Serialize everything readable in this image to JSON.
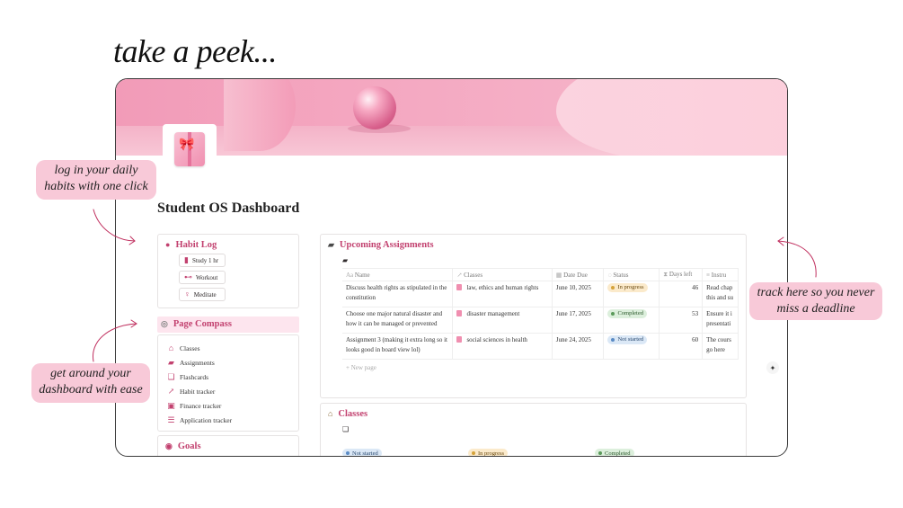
{
  "headline": "take a peek...",
  "page": {
    "title": "Student OS Dashboard"
  },
  "habit_log": {
    "title": "Habit Log",
    "buttons": [
      {
        "label": "Study 1 hr",
        "icon": "book-icon"
      },
      {
        "label": "Workout",
        "icon": "dumbbell-icon"
      },
      {
        "label": "Meditate",
        "icon": "meditate-icon"
      }
    ]
  },
  "page_compass": {
    "title": "Page Compass",
    "items": [
      {
        "label": "Classes",
        "icon": "school-icon"
      },
      {
        "label": "Assignments",
        "icon": "open-book-icon"
      },
      {
        "label": "Flashcards",
        "icon": "cards-icon"
      },
      {
        "label": "Habit tracker",
        "icon": "chart-icon"
      },
      {
        "label": "Finance tracker",
        "icon": "money-icon"
      },
      {
        "label": "Application tracker",
        "icon": "list-icon"
      }
    ]
  },
  "goals": {
    "title": "Goals"
  },
  "assignments": {
    "title": "Upcoming Assignments",
    "columns": [
      "Name",
      "Classes",
      "Date Due",
      "Status",
      "Days left",
      "Instru"
    ],
    "rows": [
      {
        "name": "Discuss health rights as stipulated in the constitution",
        "class": "law, ethics and human rights",
        "due": "June 10, 2025",
        "status": "In progress",
        "status_kind": "prog",
        "days_left": "46",
        "instructions": "Read chap this and su"
      },
      {
        "name": "Choose one major natural disaster and how it can be managed or prevented",
        "class": "disaster management",
        "due": "June 17, 2025",
        "status": "Completed",
        "status_kind": "done",
        "days_left": "53",
        "instructions": "Ensure it i presentati"
      },
      {
        "name": "Assignment 3 (making it extra long so it looks good in board view lol)",
        "class": "social sciences in health",
        "due": "June 24, 2025",
        "status": "Not started",
        "status_kind": "todo",
        "days_left": "60",
        "instructions": "The cours go here"
      }
    ],
    "new_page": "New page"
  },
  "classes": {
    "title": "Classes",
    "groups": [
      "Not started",
      "In progress",
      "Completed"
    ]
  },
  "callouts": {
    "habits": "log in your daily habits with one click",
    "navigate": "get around your dashboard with ease",
    "deadlines": "track here so you never miss a deadline"
  },
  "colors": {
    "accent": "#c2416f",
    "callout_bg": "#f8c9d8",
    "cover_pink": "#f4a8c1"
  }
}
